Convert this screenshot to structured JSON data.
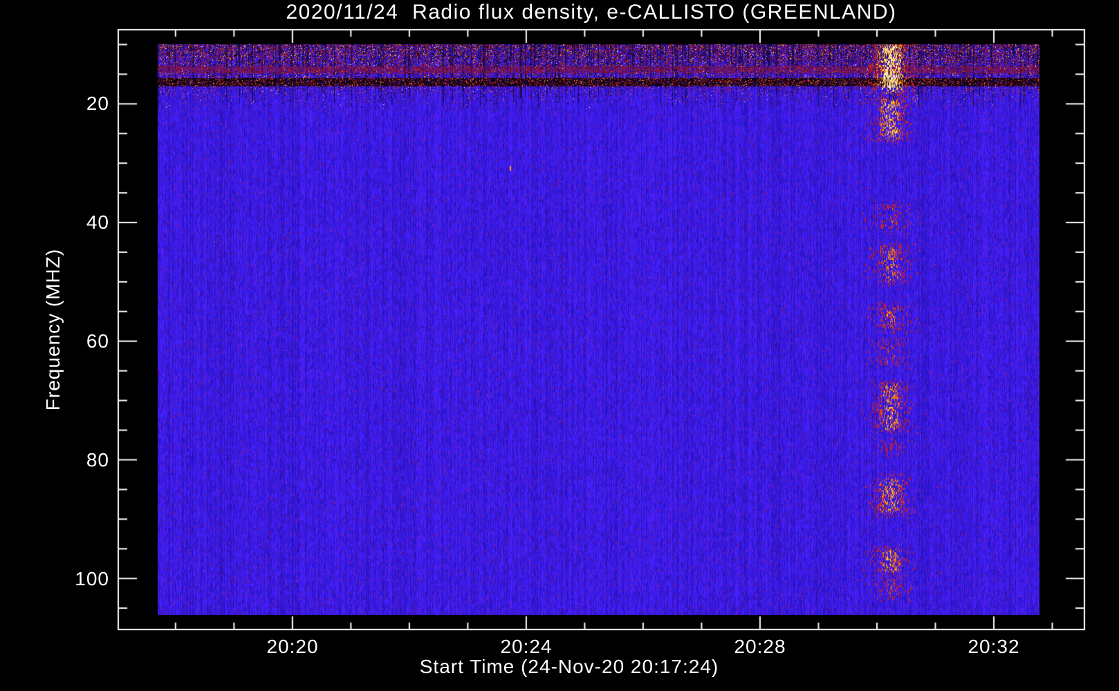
{
  "window": {
    "background": "#000000"
  },
  "chart_data": {
    "type": "heatmap",
    "title": "2020/11/24  Radio flux density, e-CALLISTO (GREENLAND)",
    "date": "2020/11/24",
    "instrument": "e-CALLISTO",
    "station": "GREENLAND",
    "xlabel": "Start Time (24-Nov-20 20:17:24)",
    "ylabel": "Frequency (MHZ)",
    "start_time": "24-Nov-20 20:17:24",
    "x_axis": {
      "unit": "UT time, minutes after 20:00",
      "range_min": [
        17.02,
        33.55
      ],
      "major_ticks": [
        {
          "t": 20,
          "label": "20:20"
        },
        {
          "t": 24,
          "label": "20:24"
        },
        {
          "t": 28,
          "label": "20:28"
        },
        {
          "t": 32,
          "label": "20:32"
        }
      ],
      "minor_tick_every_min": 1
    },
    "y_axis": {
      "unit": "MHz",
      "inverted": true,
      "range_mhz": [
        7.5,
        108.6
      ],
      "major_ticks": [
        {
          "f": 20,
          "label": "20"
        },
        {
          "f": 40,
          "label": "40"
        },
        {
          "f": 60,
          "label": "60"
        },
        {
          "f": 80,
          "label": "80"
        },
        {
          "f": 100,
          "label": "100"
        }
      ],
      "minor_tick_every_mhz": 5
    },
    "image": {
      "time_span_min": [
        17.69,
        32.78
      ],
      "freq_span_mhz": [
        9.9,
        106.2
      ],
      "background": "quiet blue continuum with fine vertical noise striation and sparse purple/red speckles"
    },
    "palette": {
      "page_background": "#000000",
      "axis_and_text": "#ffffff",
      "quiet_emission_blue": "#2214e6",
      "speckle_purple": "#7a1478",
      "rfi_dark_red": "#8c1420",
      "rfi_red": "#cc2814",
      "burst_orange": "#ff7d14",
      "burst_yellow": "#ffd23c",
      "burst_white": "#fff5c8"
    },
    "features": {
      "description": "Dynamic radio spectrum: quiet blue background; broadband RFI/noise band at the top (~10-18 MHz) with black dropout streaks and red speckles; two horizontal interference stripes near 14 and 16 MHz; patchy broadband solar radio burst near 20:30 UT extending from ~10 to ~105 MHz.",
      "top_noise_band_mhz": [
        10,
        18
      ],
      "rfi_stripes_mhz": [
        14.2,
        16.3
      ],
      "burst": {
        "time_utc": "20:29:50 - 20:30:40",
        "center_min_after_2000": 30.23,
        "sigma_min": 0.26,
        "freq_extent_mhz": [
          10,
          105
        ],
        "patches_mhz": [
          [
            10,
            18,
            1.35
          ],
          [
            19,
            26,
            0.95
          ],
          [
            37,
            41,
            0.5
          ],
          [
            44,
            50,
            0.7
          ],
          [
            54,
            58,
            0.6
          ],
          [
            60,
            64,
            0.5
          ],
          [
            67,
            75,
            0.8
          ],
          [
            77,
            79,
            0.35
          ],
          [
            83,
            89,
            0.85
          ],
          [
            95,
            99,
            0.8
          ],
          [
            100,
            103,
            0.5
          ]
        ]
      },
      "isolated_dot": {
        "t_min": 23.72,
        "freq_mhz": 30.5
      }
    }
  }
}
